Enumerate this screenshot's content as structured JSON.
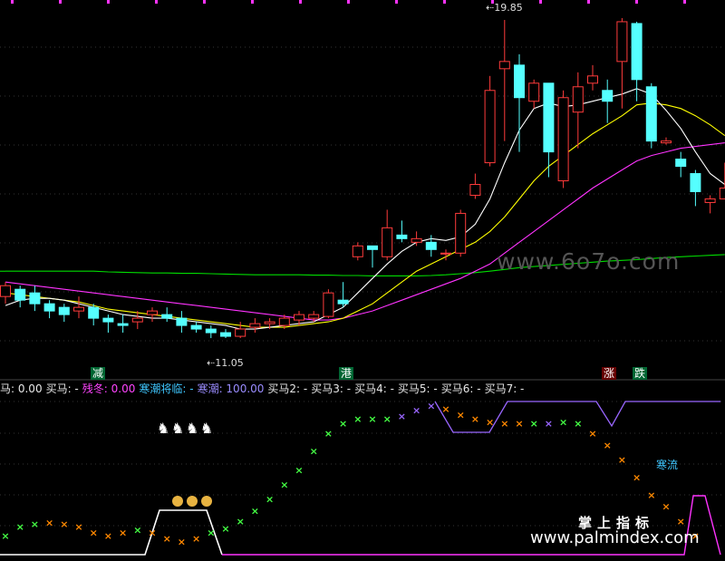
{
  "colors": {
    "up": "#ff3b3b",
    "down": "#5ff",
    "ma5": "#ffffff",
    "ma10": "#ffff00",
    "ma20": "#ff33ff",
    "ma60": "#00dd00",
    "buy": "#44ff44",
    "sell": "#ff8800",
    "strong": "#9966ff"
  },
  "price_labels": {
    "high": "19.85",
    "low": "11.05"
  },
  "tags": {
    "t1": "减",
    "t2": "港",
    "t3": "涨",
    "t4": "跌"
  },
  "legend": [
    {
      "text": "马: 0.00",
      "color": "#e8e8e8"
    },
    {
      "text": "买马: -",
      "color": "#e8e8e8"
    },
    {
      "text": "残冬: 0.00",
      "color": "#ff44ff"
    },
    {
      "text": "寒潮将临: -",
      "color": "#3fc7ff"
    },
    {
      "text": "寒潮: 100.00",
      "color": "#9a8cff"
    },
    {
      "text": "买马2: -",
      "color": "#e8e8e8"
    },
    {
      "text": "买马3: -",
      "color": "#e8e8e8"
    },
    {
      "text": "买马4: -",
      "color": "#e8e8e8"
    },
    {
      "text": "买马5: -",
      "color": "#e8e8e8"
    },
    {
      "text": "买马6: -",
      "color": "#e8e8e8"
    },
    {
      "text": "买马7: -",
      "color": "#e8e8e8"
    }
  ],
  "indicator_label": "寒流",
  "watermarks": {
    "site1": "www.6o7o.com",
    "brand": "掌上指标",
    "site2": "www.palmindex.com"
  },
  "chart_data": {
    "type": "candlestick",
    "title": "",
    "price_range": [
      10.5,
      20.2
    ],
    "candles": [
      [
        12.2,
        12.5,
        12.6,
        12.0
      ],
      [
        12.4,
        12.1,
        12.5,
        11.9
      ],
      [
        12.3,
        12.0,
        12.5,
        11.8
      ],
      [
        12.0,
        11.8,
        12.1,
        11.6
      ],
      [
        11.9,
        11.7,
        12.0,
        11.5
      ],
      [
        11.8,
        11.9,
        12.2,
        11.6
      ],
      [
        11.9,
        11.6,
        12.0,
        11.4
      ],
      [
        11.6,
        11.5,
        11.7,
        11.2
      ],
      [
        11.45,
        11.4,
        11.7,
        11.2
      ],
      [
        11.5,
        11.6,
        11.8,
        11.3
      ],
      [
        11.7,
        11.8,
        11.9,
        11.5
      ],
      [
        11.7,
        11.6,
        11.9,
        11.5
      ],
      [
        11.6,
        11.4,
        11.8,
        11.2
      ],
      [
        11.4,
        11.3,
        11.5,
        11.2
      ],
      [
        11.3,
        11.2,
        11.4,
        11.05
      ],
      [
        11.2,
        11.1,
        11.3,
        11.05
      ],
      [
        11.1,
        11.3,
        11.5,
        11.05
      ],
      [
        11.35,
        11.45,
        11.6,
        11.2
      ],
      [
        11.45,
        11.5,
        11.6,
        11.3
      ],
      [
        11.4,
        11.6,
        11.7,
        11.3
      ],
      [
        11.55,
        11.7,
        11.8,
        11.4
      ],
      [
        11.6,
        11.7,
        11.8,
        11.5
      ],
      [
        11.65,
        12.3,
        12.4,
        11.6
      ],
      [
        12.1,
        12.0,
        12.6,
        11.9
      ],
      [
        13.3,
        13.6,
        13.7,
        13.2
      ],
      [
        13.6,
        13.5,
        13.6,
        13.0
      ],
      [
        13.3,
        14.1,
        14.6,
        13.2
      ],
      [
        13.9,
        13.8,
        14.3,
        13.7
      ],
      [
        13.7,
        13.8,
        14.0,
        13.6
      ],
      [
        13.7,
        13.5,
        13.9,
        13.3
      ],
      [
        13.4,
        13.4,
        13.5,
        13.2
      ],
      [
        13.4,
        14.5,
        14.6,
        13.3
      ],
      [
        15.0,
        15.3,
        15.6,
        14.9
      ],
      [
        15.9,
        17.9,
        18.3,
        15.8
      ],
      [
        18.5,
        18.7,
        19.85,
        16.5
      ],
      [
        18.6,
        17.7,
        18.9,
        16.2
      ],
      [
        17.6,
        18.1,
        18.2,
        17.4
      ],
      [
        18.1,
        16.2,
        18.1,
        15.5
      ],
      [
        15.4,
        17.7,
        17.9,
        15.2
      ],
      [
        17.3,
        18.0,
        18.4,
        16.3
      ],
      [
        18.1,
        18.3,
        18.6,
        17.9
      ],
      [
        17.9,
        17.6,
        18.2,
        17.0
      ],
      [
        18.7,
        19.8,
        19.9,
        17.4
      ],
      [
        19.75,
        18.2,
        19.8,
        17.6
      ],
      [
        18.0,
        16.5,
        18.1,
        16.3
      ],
      [
        16.45,
        16.5,
        16.6,
        16.4
      ],
      [
        16.0,
        15.8,
        16.2,
        15.5
      ],
      [
        15.6,
        15.1,
        15.7,
        14.7
      ],
      [
        14.8,
        14.9,
        15.0,
        14.5
      ],
      [
        14.9,
        15.2,
        15.9,
        15.0
      ]
    ],
    "ma": {
      "ma5": [
        11.95,
        12.1,
        12.15,
        12.15,
        12.1,
        12.0,
        11.9,
        11.8,
        11.7,
        11.65,
        11.6,
        11.6,
        11.55,
        11.5,
        11.45,
        11.4,
        11.3,
        11.3,
        11.35,
        11.4,
        11.45,
        11.5,
        11.7,
        11.9,
        12.3,
        12.7,
        13.1,
        13.45,
        13.7,
        13.8,
        13.75,
        13.85,
        14.2,
        14.9,
        15.9,
        16.8,
        17.4,
        17.55,
        17.45,
        17.5,
        17.6,
        17.7,
        17.8,
        17.95,
        17.8,
        17.35,
        16.85,
        16.2,
        15.6,
        15.3
      ],
      "ma10": [
        12.3,
        12.25,
        12.2,
        12.15,
        12.1,
        12.05,
        11.95,
        11.85,
        11.8,
        11.75,
        11.7,
        11.65,
        11.6,
        11.55,
        11.5,
        11.45,
        11.4,
        11.35,
        11.35,
        11.35,
        11.4,
        11.45,
        11.5,
        11.6,
        11.8,
        12.0,
        12.3,
        12.6,
        12.9,
        13.1,
        13.3,
        13.5,
        13.7,
        14.0,
        14.4,
        14.9,
        15.4,
        15.8,
        16.1,
        16.4,
        16.7,
        16.95,
        17.2,
        17.5,
        17.55,
        17.5,
        17.4,
        17.2,
        16.95,
        16.65
      ],
      "ma20": [
        12.6,
        12.55,
        12.5,
        12.45,
        12.4,
        12.35,
        12.3,
        12.25,
        12.2,
        12.15,
        12.1,
        12.05,
        12.0,
        11.95,
        11.9,
        11.85,
        11.8,
        11.75,
        11.7,
        11.65,
        11.6,
        11.55,
        11.55,
        11.6,
        11.7,
        11.8,
        11.95,
        12.1,
        12.25,
        12.4,
        12.55,
        12.7,
        12.9,
        13.1,
        13.4,
        13.7,
        14.0,
        14.3,
        14.6,
        14.9,
        15.2,
        15.45,
        15.7,
        15.95,
        16.1,
        16.2,
        16.3,
        16.35,
        16.4,
        16.45
      ],
      "ma60": [
        12.9,
        12.9,
        12.9,
        12.9,
        12.9,
        12.9,
        12.9,
        12.88,
        12.87,
        12.86,
        12.85,
        12.85,
        12.84,
        12.84,
        12.83,
        12.82,
        12.81,
        12.8,
        12.8,
        12.8,
        12.8,
        12.79,
        12.79,
        12.78,
        12.78,
        12.77,
        12.77,
        12.77,
        12.77,
        12.78,
        12.8,
        12.83,
        12.86,
        12.9,
        12.95,
        13.0,
        13.03,
        13.06,
        13.09,
        13.12,
        13.15,
        13.18,
        13.2,
        13.22,
        13.25,
        13.28,
        13.3,
        13.32,
        13.34,
        13.36
      ]
    },
    "indicator": {
      "points": [
        [
          0,
          0.1,
          "g"
        ],
        [
          1,
          0.16,
          "g"
        ],
        [
          2,
          0.18,
          "g"
        ],
        [
          3,
          0.19,
          "s"
        ],
        [
          4,
          0.18,
          "s"
        ],
        [
          5,
          0.16,
          "s"
        ],
        [
          6,
          0.12,
          "s"
        ],
        [
          7,
          0.1,
          "s"
        ],
        [
          8,
          0.12,
          "s"
        ],
        [
          9,
          0.14,
          "g"
        ],
        [
          10,
          0.12,
          "s"
        ],
        [
          11,
          0.08,
          "s"
        ],
        [
          12,
          0.06,
          "s"
        ],
        [
          13,
          0.08,
          "s"
        ],
        [
          14,
          0.12,
          "g"
        ],
        [
          15,
          0.15,
          "g"
        ],
        [
          16,
          0.2,
          "g"
        ],
        [
          17,
          0.27,
          "g"
        ],
        [
          18,
          0.35,
          "g"
        ],
        [
          19,
          0.45,
          "g"
        ],
        [
          20,
          0.55,
          "g"
        ],
        [
          21,
          0.68,
          "g"
        ],
        [
          22,
          0.8,
          "g"
        ],
        [
          23,
          0.87,
          "g"
        ],
        [
          24,
          0.9,
          "g"
        ],
        [
          25,
          0.9,
          "g"
        ],
        [
          26,
          0.9,
          "g"
        ],
        [
          27,
          0.92,
          "p"
        ],
        [
          28,
          0.96,
          "p"
        ],
        [
          29,
          0.99,
          "p"
        ],
        [
          30,
          0.97,
          "s"
        ],
        [
          31,
          0.93,
          "s"
        ],
        [
          32,
          0.9,
          "s"
        ],
        [
          33,
          0.88,
          "s"
        ],
        [
          34,
          0.87,
          "s"
        ],
        [
          35,
          0.87,
          "s"
        ],
        [
          36,
          0.87,
          "g"
        ],
        [
          37,
          0.87,
          "p"
        ],
        [
          38,
          0.88,
          "g"
        ],
        [
          39,
          0.87,
          "g"
        ],
        [
          40,
          0.8,
          "s"
        ],
        [
          41,
          0.72,
          "s"
        ],
        [
          42,
          0.62,
          "s"
        ],
        [
          43,
          0.5,
          "s"
        ],
        [
          44,
          0.38,
          "s"
        ],
        [
          45,
          0.3,
          "s"
        ],
        [
          46,
          0.2,
          "s"
        ],
        [
          47,
          0.1,
          "s"
        ]
      ],
      "ylim": [
        0,
        1
      ]
    }
  }
}
